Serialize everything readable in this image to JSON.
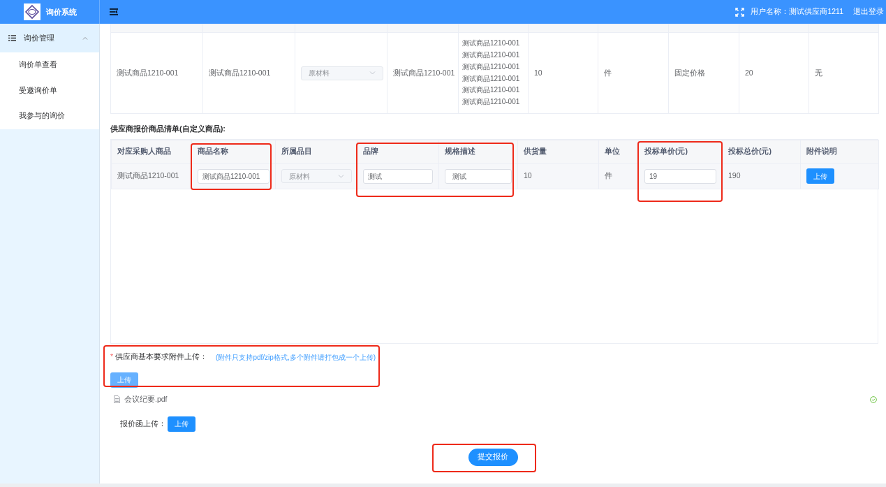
{
  "header": {
    "title": "询价系统",
    "user": "用户名称：测试供应商1211",
    "logout": "退出登录"
  },
  "sidebar": {
    "group": {
      "label": "询价管理",
      "expanded": true
    },
    "items": [
      {
        "label": "询价单查看"
      },
      {
        "label": "受邀询价单"
      },
      {
        "label": "我参与的询价"
      }
    ]
  },
  "top_table": {
    "rows": [
      {
        "cells": [
          {
            "kind": "text",
            "text": "测试商品1210-001"
          },
          {
            "kind": "text",
            "text": "测试商品1210-001"
          },
          {
            "kind": "select",
            "text": "原材料",
            "disabled": true
          },
          {
            "kind": "text",
            "text": "测试商品1210-001"
          },
          {
            "kind": "lines",
            "lines": [
              "测试商品1210-001",
              "测试商品1210-001",
              "测试商品1210-001",
              "测试商品1210-001",
              "测试商品1210-001",
              "测试商品1210-001"
            ]
          },
          {
            "kind": "text",
            "text": "10"
          },
          {
            "kind": "text",
            "text": "件"
          },
          {
            "kind": "text",
            "text": "固定价格"
          },
          {
            "kind": "text",
            "text": "20"
          },
          {
            "kind": "text",
            "text": "无"
          }
        ]
      }
    ]
  },
  "quote_section": {
    "title": "供应商报价商品清单(自定义商品):",
    "columns": [
      "对应采购人商品",
      "商品名称",
      "所属品目",
      "品牌",
      "规格描述",
      "供货量",
      "单位",
      "投标单价(元)",
      "投标总价(元)",
      "附件说明"
    ],
    "rows": [
      {
        "cells": [
          {
            "kind": "text",
            "text": "测试商品1210-001"
          },
          {
            "kind": "input",
            "value": "测试商品1210-001"
          },
          {
            "kind": "select",
            "text": "原材料",
            "disabled": true
          },
          {
            "kind": "input",
            "value": "测试"
          },
          {
            "kind": "textarea",
            "value": "测试"
          },
          {
            "kind": "text",
            "text": "10"
          },
          {
            "kind": "text",
            "text": "件"
          },
          {
            "kind": "input",
            "value": "19"
          },
          {
            "kind": "text",
            "text": "190"
          },
          {
            "kind": "button",
            "text": "上传"
          }
        ]
      }
    ]
  },
  "attachment_upload": {
    "required_mark": "*",
    "label": "供应商基本要求附件上传：",
    "hint": "(附件只支持pdf/zip格式,多个附件请打包成一个上传)",
    "button": {
      "text": "上传",
      "disabled": true
    },
    "files": [
      {
        "name": "会议纪要.pdf",
        "uploaded": true
      }
    ]
  },
  "quote_letter_upload": {
    "label": "报价函上传：",
    "button": {
      "text": "上传",
      "disabled": false
    }
  },
  "submit_button": "提交报价"
}
